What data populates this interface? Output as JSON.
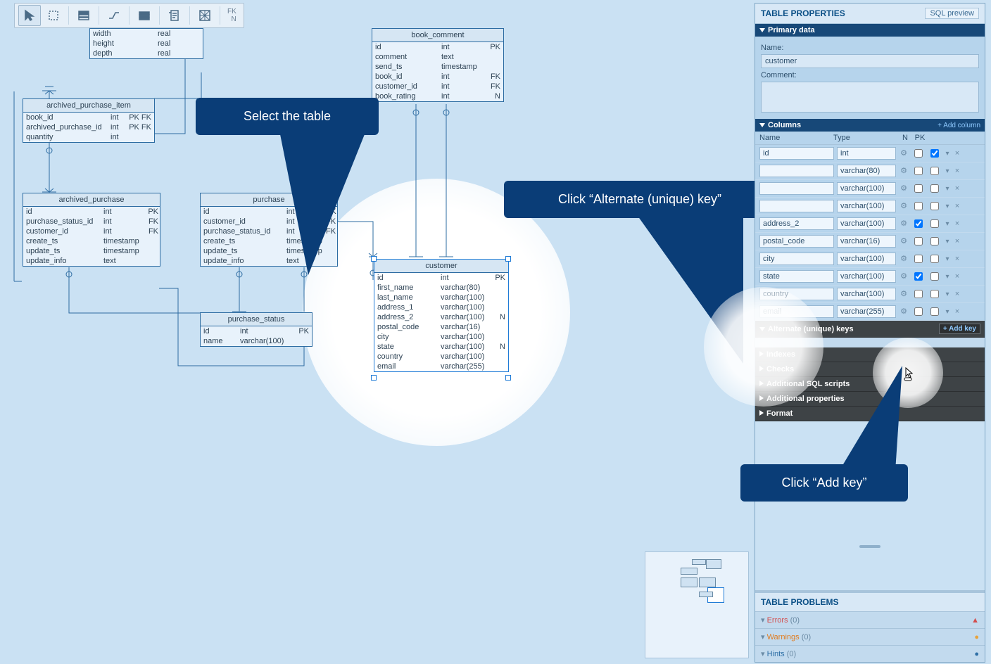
{
  "toolbar": {
    "fk": "FK",
    "n": "N"
  },
  "panel": {
    "title": "TABLE PROPERTIES",
    "sql_preview": "SQL preview",
    "primary": {
      "header": "Primary data",
      "name_label": "Name:",
      "name_value": "customer",
      "comment_label": "Comment:",
      "comment_value": ""
    },
    "columns": {
      "header": "Columns",
      "add": "+ Add column",
      "hdr_name": "Name",
      "hdr_type": "Type",
      "hdr_n": "N",
      "hdr_pk": "PK",
      "rows": [
        {
          "name": "id",
          "type": "int",
          "n": false,
          "pk": true
        },
        {
          "name": "",
          "type": "varchar(80)",
          "n": false,
          "pk": false
        },
        {
          "name": "",
          "type": "varchar(100)",
          "n": false,
          "pk": false
        },
        {
          "name": "",
          "type": "varchar(100)",
          "n": false,
          "pk": false
        },
        {
          "name": "address_2",
          "type": "varchar(100)",
          "n": true,
          "pk": false
        },
        {
          "name": "postal_code",
          "type": "varchar(16)",
          "n": false,
          "pk": false
        },
        {
          "name": "city",
          "type": "varchar(100)",
          "n": false,
          "pk": false
        },
        {
          "name": "state",
          "type": "varchar(100)",
          "n": true,
          "pk": false
        },
        {
          "name": "country",
          "type": "varchar(100)",
          "n": false,
          "pk": false
        },
        {
          "name": "email",
          "type": "varchar(255)",
          "n": false,
          "pk": false
        }
      ]
    },
    "alt_keys": {
      "header": "Alternate (unique) keys",
      "add": "+ Add key"
    },
    "sections": {
      "indexes": "Indexes",
      "checks": "Checks",
      "sql": "Additional SQL scripts",
      "props": "Additional properties",
      "format": "Format"
    },
    "problems": {
      "title": "TABLE PROBLEMS",
      "errors": "Errors",
      "errors_n": "(0)",
      "warnings": "Warnings",
      "warnings_n": "(0)",
      "hints": "Hints",
      "hints_n": "(0)"
    }
  },
  "callouts": {
    "select_table": "Select the table",
    "alt_key": "Click “Alternate (unique) key”",
    "add_key": "Click “Add key”"
  },
  "tables": {
    "dims": {
      "rows": [
        {
          "name": "width",
          "type": "real",
          "meta": ""
        },
        {
          "name": "height",
          "type": "real",
          "meta": ""
        },
        {
          "name": "depth",
          "type": "real",
          "meta": ""
        }
      ]
    },
    "archived_purchase_item": {
      "title": "archived_purchase_item",
      "rows": [
        {
          "name": "book_id",
          "type": "int",
          "meta": "PK FK"
        },
        {
          "name": "archived_purchase_id",
          "type": "int",
          "meta": "PK FK"
        },
        {
          "name": "quantity",
          "type": "int",
          "meta": ""
        }
      ]
    },
    "archived_purchase": {
      "title": "archived_purchase",
      "rows": [
        {
          "name": "id",
          "type": "int",
          "meta": "PK"
        },
        {
          "name": "purchase_status_id",
          "type": "int",
          "meta": "FK"
        },
        {
          "name": "customer_id",
          "type": "int",
          "meta": "FK"
        },
        {
          "name": "create_ts",
          "type": "timestamp",
          "meta": ""
        },
        {
          "name": "update_ts",
          "type": "timestamp",
          "meta": ""
        },
        {
          "name": "update_info",
          "type": "text",
          "meta": ""
        }
      ]
    },
    "purchase": {
      "title": "purchase",
      "rows": [
        {
          "name": "id",
          "type": "int",
          "meta": "PK"
        },
        {
          "name": "customer_id",
          "type": "int",
          "meta": "FK"
        },
        {
          "name": "purchase_status_id",
          "type": "int",
          "meta": "FK"
        },
        {
          "name": "create_ts",
          "type": "timestamp",
          "meta": ""
        },
        {
          "name": "update_ts",
          "type": "timestamp",
          "meta": ""
        },
        {
          "name": "update_info",
          "type": "text",
          "meta": ""
        }
      ]
    },
    "purchase_status": {
      "title": "purchase_status",
      "rows": [
        {
          "name": "id",
          "type": "int",
          "meta": "PK"
        },
        {
          "name": "name",
          "type": "varchar(100)",
          "meta": ""
        }
      ]
    },
    "book_comment": {
      "title": "book_comment",
      "rows": [
        {
          "name": "id",
          "type": "int",
          "meta": "PK"
        },
        {
          "name": "comment",
          "type": "text",
          "meta": ""
        },
        {
          "name": "send_ts",
          "type": "timestamp",
          "meta": ""
        },
        {
          "name": "book_id",
          "type": "int",
          "meta": "FK"
        },
        {
          "name": "customer_id",
          "type": "int",
          "meta": "FK"
        },
        {
          "name": "book_rating",
          "type": "int",
          "meta": "N"
        }
      ]
    },
    "customer": {
      "title": "customer",
      "rows": [
        {
          "name": "id",
          "type": "int",
          "meta": "PK"
        },
        {
          "name": "first_name",
          "type": "varchar(80)",
          "meta": ""
        },
        {
          "name": "last_name",
          "type": "varchar(100)",
          "meta": ""
        },
        {
          "name": "address_1",
          "type": "varchar(100)",
          "meta": ""
        },
        {
          "name": "address_2",
          "type": "varchar(100)",
          "meta": "N"
        },
        {
          "name": "postal_code",
          "type": "varchar(16)",
          "meta": ""
        },
        {
          "name": "city",
          "type": "varchar(100)",
          "meta": ""
        },
        {
          "name": "state",
          "type": "varchar(100)",
          "meta": "N"
        },
        {
          "name": "country",
          "type": "varchar(100)",
          "meta": ""
        },
        {
          "name": "email",
          "type": "varchar(255)",
          "meta": ""
        }
      ]
    }
  }
}
